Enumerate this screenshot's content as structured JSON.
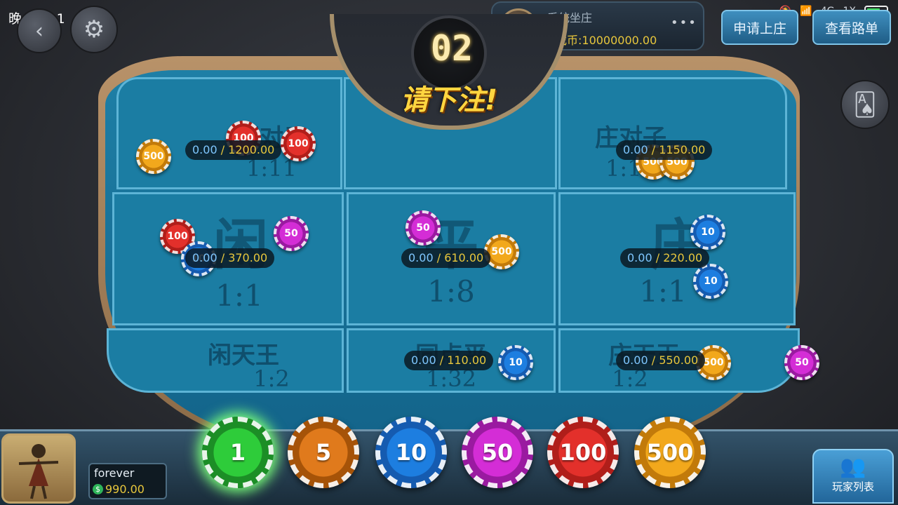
{
  "status_bar": {
    "time": "晚上8:11",
    "network": "4G",
    "network2": "1X"
  },
  "banker": {
    "icon_text": "庄",
    "name": "系统坐庄",
    "coins_label": "游戏币:10000000.00",
    "menu": "•••"
  },
  "buttons": {
    "apply_banker": "申请上庄",
    "view_history": "查看路单",
    "player_list": "玩家列表"
  },
  "countdown": {
    "seconds": "02",
    "prompt": "请下注!"
  },
  "bet_areas": [
    {
      "id": "player-pair",
      "name": "闲对子",
      "odds": "1:11",
      "mine": "0.00",
      "total": " / 1200.00"
    },
    {
      "id": "banker-pair",
      "name": "庄对子",
      "odds": "1:11",
      "mine": "0.00",
      "total": " / 1150.00"
    },
    {
      "id": "player",
      "name": "闲",
      "odds": "1:1",
      "mine": "0.00",
      "total": " / 370.00"
    },
    {
      "id": "tie",
      "name": "平",
      "odds": "1:8",
      "mine": "0.00",
      "total": " / 610.00"
    },
    {
      "id": "banker",
      "name": "庄",
      "odds": "1:1",
      "mine": "0.00",
      "total": " / 220.00"
    },
    {
      "id": "player-natural",
      "name": "闲天王",
      "odds": "1:2",
      "mine": "0.00",
      "total": ""
    },
    {
      "id": "same-point-tie",
      "name": "同点平",
      "odds": "1:32",
      "mine": "0.00",
      "total": " / 110.00"
    },
    {
      "id": "banker-natural",
      "name": "庄天王",
      "odds": "1:2",
      "mine": "0.00",
      "total": " / 550.00"
    }
  ],
  "table_chips": [
    "500",
    "100",
    "100",
    "50",
    "10",
    "50",
    "500",
    "10",
    "10",
    "100",
    "10",
    "50",
    "500",
    "500",
    "500"
  ],
  "player": {
    "name": "forever",
    "coins": "990.00",
    "coin_symbol": "$"
  },
  "chip_selector": [
    {
      "value": "1",
      "color": "#2ecc3a",
      "selected": true
    },
    {
      "value": "5",
      "color": "#e07a1c",
      "selected": false
    },
    {
      "value": "10",
      "color": "#1d7ee0",
      "selected": false
    },
    {
      "value": "50",
      "color": "#d42dd6",
      "selected": false
    },
    {
      "value": "100",
      "color": "#e3302b",
      "selected": false
    },
    {
      "value": "500",
      "color": "#f2a81c",
      "selected": false
    }
  ],
  "colors": {
    "felt": "#1b7da3",
    "gold": "#e8c73c",
    "chip_blue": "#7fc7ff"
  }
}
